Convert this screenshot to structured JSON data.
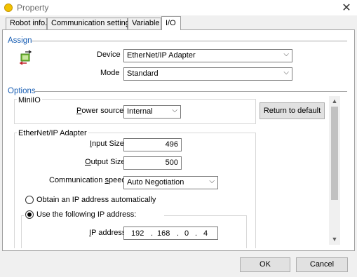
{
  "window": {
    "title": "Property",
    "close_glyph": "✕"
  },
  "tabs": [
    {
      "label": "Robot info.",
      "active": false
    },
    {
      "label": "Communication setting",
      "active": false
    },
    {
      "label": "Variable",
      "active": false
    },
    {
      "label": "I/O",
      "active": true
    }
  ],
  "assign": {
    "section_label": "Assign",
    "icon": "io-transfer-icon",
    "device_label": "Device",
    "device_value": "EtherNet/IP Adapter",
    "mode_label": "Mode",
    "mode_value": "Standard"
  },
  "options": {
    "section_label": "Options",
    "minio": {
      "group_label": "MiniIO",
      "power_label_prefix": "P",
      "power_label_rest": "ower source:",
      "power_value": "Internal"
    },
    "return_default_label": "Return to default",
    "ethernet": {
      "group_label": "EtherNet/IP Adapter",
      "input_size_prefix": "I",
      "input_size_rest": "nput Size",
      "input_size_value": "496",
      "output_size_prefix": "O",
      "output_size_rest": "utput Size",
      "output_size_value": "500",
      "comm_speed_prefix": "Communication ",
      "comm_speed_underline": "s",
      "comm_speed_rest": "peed",
      "comm_speed_value": "Auto Negotiation",
      "radio_auto_label": "Obtain an IP address automatically",
      "radio_manual_label": "Use the following IP address:",
      "selected_radio": "manual",
      "ip_label_prefix": "I",
      "ip_label_rest": "P address",
      "ip": [
        "192",
        "168",
        "0",
        "4"
      ]
    }
  },
  "footer": {
    "ok_label": "OK",
    "cancel_label": "Cancel"
  },
  "colors": {
    "section_label": "#1a5fb4",
    "title_icon": "#f2c200"
  }
}
